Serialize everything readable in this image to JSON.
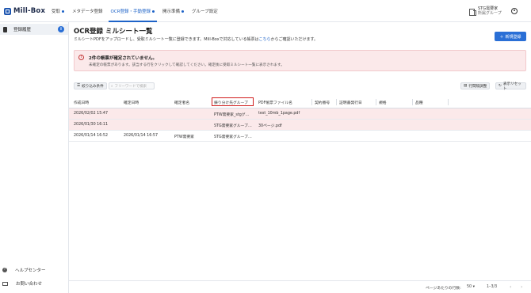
{
  "app": {
    "name": "Mill-Box"
  },
  "nav": {
    "items": [
      {
        "label": "受取",
        "dot": true
      },
      {
        "label": "メタデータ登録",
        "dot": false
      },
      {
        "label": "OCR登録・手動登録",
        "dot": true,
        "active": true
      },
      {
        "label": "開示準備",
        "dot": true
      },
      {
        "label": "グループ設定",
        "dot": false
      }
    ]
  },
  "org": {
    "name": "STG需要家",
    "group": "所属グループ"
  },
  "sidebar": {
    "items": [
      {
        "label": "登録履歴",
        "badge": "i"
      }
    ],
    "bottom": [
      {
        "label": "ヘルプセンター"
      },
      {
        "label": "お問い合わせ"
      }
    ]
  },
  "main": {
    "title": "OCR登録 ミルシート一覧",
    "desc_before": "ミルシートPDFをアップロードし、受取ミルシート一覧に登録できます。Mill-Boxで対応している帳票は",
    "desc_link": "こちら",
    "desc_after": "からご確認いただけます。",
    "new_button": "新規登録"
  },
  "alert": {
    "title": "2件の帳票が確定されていません。",
    "message": "未確定の帳票があります。該当する行をクリックして確認してください。確定後に受取ミルシート一覧に表示されます。"
  },
  "toolbar": {
    "filter_label": "絞り込み条件",
    "search_placeholder": "フリーワードで検索",
    "columns_label": "行間隔調整",
    "reset_label": "表示リセット"
  },
  "table": {
    "columns": [
      "作成日時",
      "確定日時",
      "確定者名",
      "振り分け先グループ",
      "PDF帳票ファイル名",
      "契約番号",
      "証明書発行日",
      "規格",
      "品種"
    ],
    "rows": [
      {
        "created": "2026/02/02 15:47",
        "confirmed": "",
        "confirmer": "",
        "group": "PTW需要家_stgグ…",
        "file": "test_10mb_1page.pdf",
        "contract": "",
        "issue_date": "",
        "standard": "",
        "kind": "",
        "unconfirmed": true
      },
      {
        "created": "2026/01/30 16:11",
        "confirmed": "",
        "confirmer": "",
        "group": "STG需要家グループ…",
        "file": "30ページ.pdf",
        "contract": "",
        "issue_date": "",
        "standard": "",
        "kind": "",
        "unconfirmed": true
      },
      {
        "created": "2026/01/14 16:52",
        "confirmed": "2026/01/14 16:57",
        "confirmer": "PTW需要家",
        "group": "STG需要家グループ…",
        "file": "",
        "contract": "",
        "issue_date": "",
        "standard": "",
        "kind": "",
        "unconfirmed": false
      }
    ]
  },
  "footer": {
    "rows_per_page_label": "ページあたりの行数:",
    "rows_per_page": "50",
    "range": "1–3/3"
  },
  "colors": {
    "accent": "#2a6fd6",
    "alert_bg": "#fbe9ea",
    "highlight": "#d01d1d"
  }
}
